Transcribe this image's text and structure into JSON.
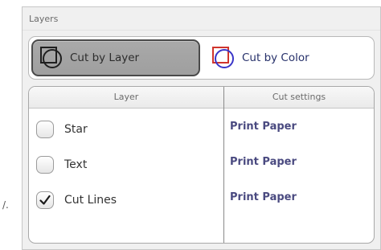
{
  "stray_text": "/.",
  "panel": {
    "title": "Layers"
  },
  "modes": {
    "cut_by_layer": {
      "label": "Cut by Layer",
      "selected": true
    },
    "cut_by_color": {
      "label": "Cut by Color",
      "selected": false
    }
  },
  "table": {
    "columns": [
      "Layer",
      "Cut settings"
    ],
    "rows": [
      {
        "name": "Star",
        "checked": false,
        "cut_setting": "Print Paper"
      },
      {
        "name": "Text",
        "checked": false,
        "cut_setting": "Print Paper"
      },
      {
        "name": "Cut Lines",
        "checked": true,
        "cut_setting": "Print Paper"
      }
    ]
  },
  "colors": {
    "selected_button_bg": "#a3a3a3",
    "link_text": "#4a4a80",
    "color_icon_square": "#d0342c",
    "color_icon_circle": "#3a35c8"
  }
}
